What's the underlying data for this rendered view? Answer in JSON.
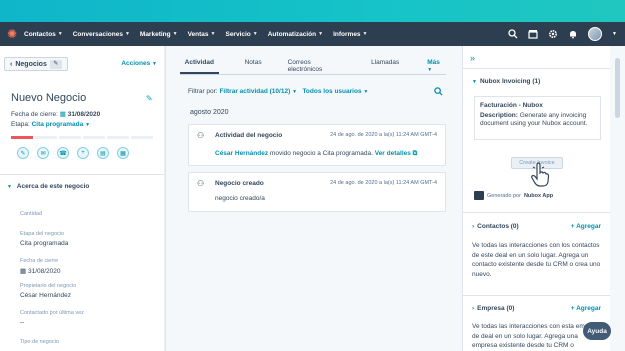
{
  "nav": {
    "items": [
      {
        "label": "Contactos"
      },
      {
        "label": "Conversaciones"
      },
      {
        "label": "Marketing"
      },
      {
        "label": "Ventas"
      },
      {
        "label": "Servicio"
      },
      {
        "label": "Automatización"
      },
      {
        "label": "Informes"
      }
    ]
  },
  "left": {
    "back_label": "Negocios",
    "acciones": "Acciones",
    "deal_title": "Nuevo Negocio",
    "close_label": "Fecha de cierre:",
    "close_date": "31/08/2020",
    "stage_label": "Etapa:",
    "stage_value": "Cita programada",
    "about_title": "Acerca de este negocio",
    "props": [
      {
        "label": "Cantidad",
        "value": ""
      },
      {
        "label": "Etapa del negocio",
        "value": "Cita programada"
      },
      {
        "label": "Fecha de cierre",
        "value": "31/08/2020"
      },
      {
        "label": "Propietario del negocio",
        "value": "César Hernández"
      },
      {
        "label": "Contactado por última vez",
        "value": "--"
      },
      {
        "label": "Tipo de negocio",
        "value": ""
      }
    ]
  },
  "middle": {
    "tabs": [
      {
        "label": "Actividad"
      },
      {
        "label": "Notas"
      },
      {
        "label": "Correos electrónicos"
      },
      {
        "label": "Llamadas"
      },
      {
        "label": "Más"
      }
    ],
    "filter_label": "Filtrar por:",
    "filter_activity": "Filtrar actividad (10/12)",
    "filter_users": "Todos los usuarios",
    "month": "agosto 2020",
    "cards": [
      {
        "title": "Actividad del negocio",
        "timestamp": "24 de ago. de 2020 a la(s) 11:24 AM GMT-4",
        "user": "César Hernández",
        "text": "movido negocio a Cita programada.",
        "link": "Ver detalles"
      },
      {
        "title": "Negocio creado",
        "timestamp": "24 de ago. de 2020 a la(s) 11:24 AM GMT-4",
        "text": "negocio creado/a"
      }
    ]
  },
  "right": {
    "nubox_title": "Nubox Invoicing (1)",
    "card_title": "Facturación - Nubox",
    "card_desc_label": "Description:",
    "card_desc": "Generate any invoicing document using your Nubox account.",
    "create_btn": "Create Invoice",
    "powered_prefix": "Generado por",
    "powered_app": "Nubox App",
    "contacts_title": "Contactos (0)",
    "contacts_add": "+ Agregar",
    "contacts_text": "Ve todas las interacciones con los contactos de este deal en un solo lugar. Agrega un contacto existente desde tu CRM o crea uno nuevo.",
    "company_title": "Empresa (0)",
    "company_add": "+ Agregar",
    "company_text": "Ve todas las interacciones con esta empresa de deal en un solo lugar. Agrega una empresa existente desde tu CRM o"
  },
  "ayuda": "Ayuda"
}
